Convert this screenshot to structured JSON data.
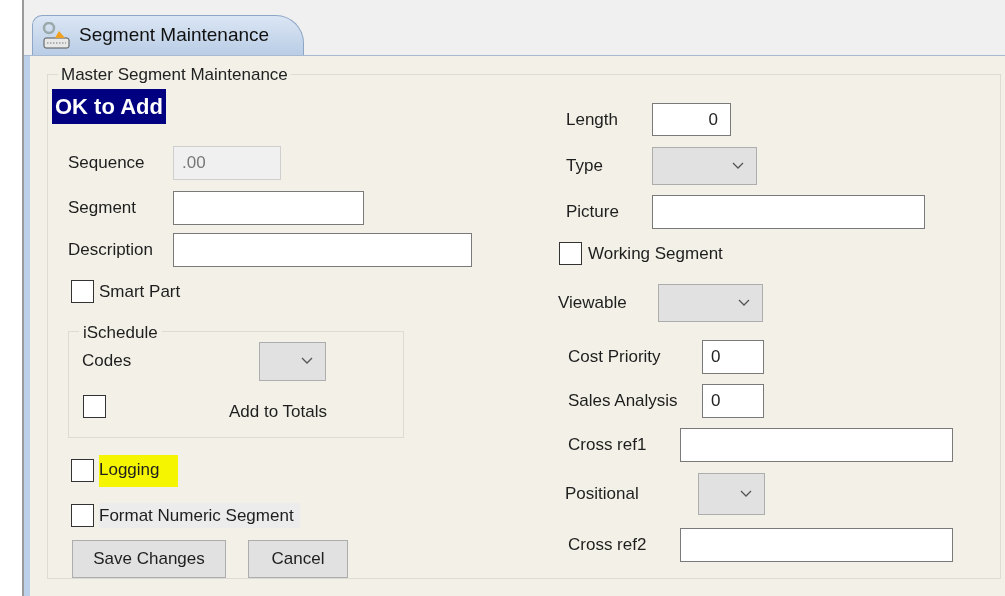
{
  "tab": {
    "label": "Segment Maintenance",
    "selected": true
  },
  "group_title": "Master Segment Maintenance",
  "status": "OK to Add",
  "left": [
    {
      "kind": "field",
      "label": "Sequence",
      "value": ".00",
      "disabled": true
    },
    {
      "kind": "field",
      "label": "Segment",
      "disabled": false
    },
    {
      "kind": "field",
      "label": "Description",
      "disabled": false
    },
    {
      "kind": "checkbox",
      "label": "Smart Part",
      "checked": false
    }
  ],
  "ischedule": {
    "title": "iSchedule",
    "codes_label": "Codes",
    "add_to_totals": {
      "label": "Add to Totals",
      "checked": false
    }
  },
  "options": [
    {
      "label": "Logging",
      "checked": false,
      "highlighted": true
    },
    {
      "label": "Format Numeric Segment",
      "checked": false,
      "highlighted": false
    }
  ],
  "buttons": [
    "Save Changes",
    "Cancel"
  ],
  "right": [
    {
      "kind": "field",
      "label": "Length",
      "value": "0"
    },
    {
      "kind": "select",
      "label": "Type"
    },
    {
      "kind": "field",
      "label": "Picture"
    },
    {
      "kind": "checkbox",
      "label": "Working Segment",
      "checked": false
    },
    {
      "kind": "select",
      "label": "Viewable"
    },
    {
      "kind": "field",
      "label": "Cost Priority",
      "value": "0"
    },
    {
      "kind": "field",
      "label": "Sales Analysis",
      "value": "0"
    },
    {
      "kind": "field",
      "label": "Cross ref1"
    },
    {
      "kind": "select",
      "label": "Positional"
    },
    {
      "kind": "field",
      "label": "Cross ref2"
    }
  ]
}
